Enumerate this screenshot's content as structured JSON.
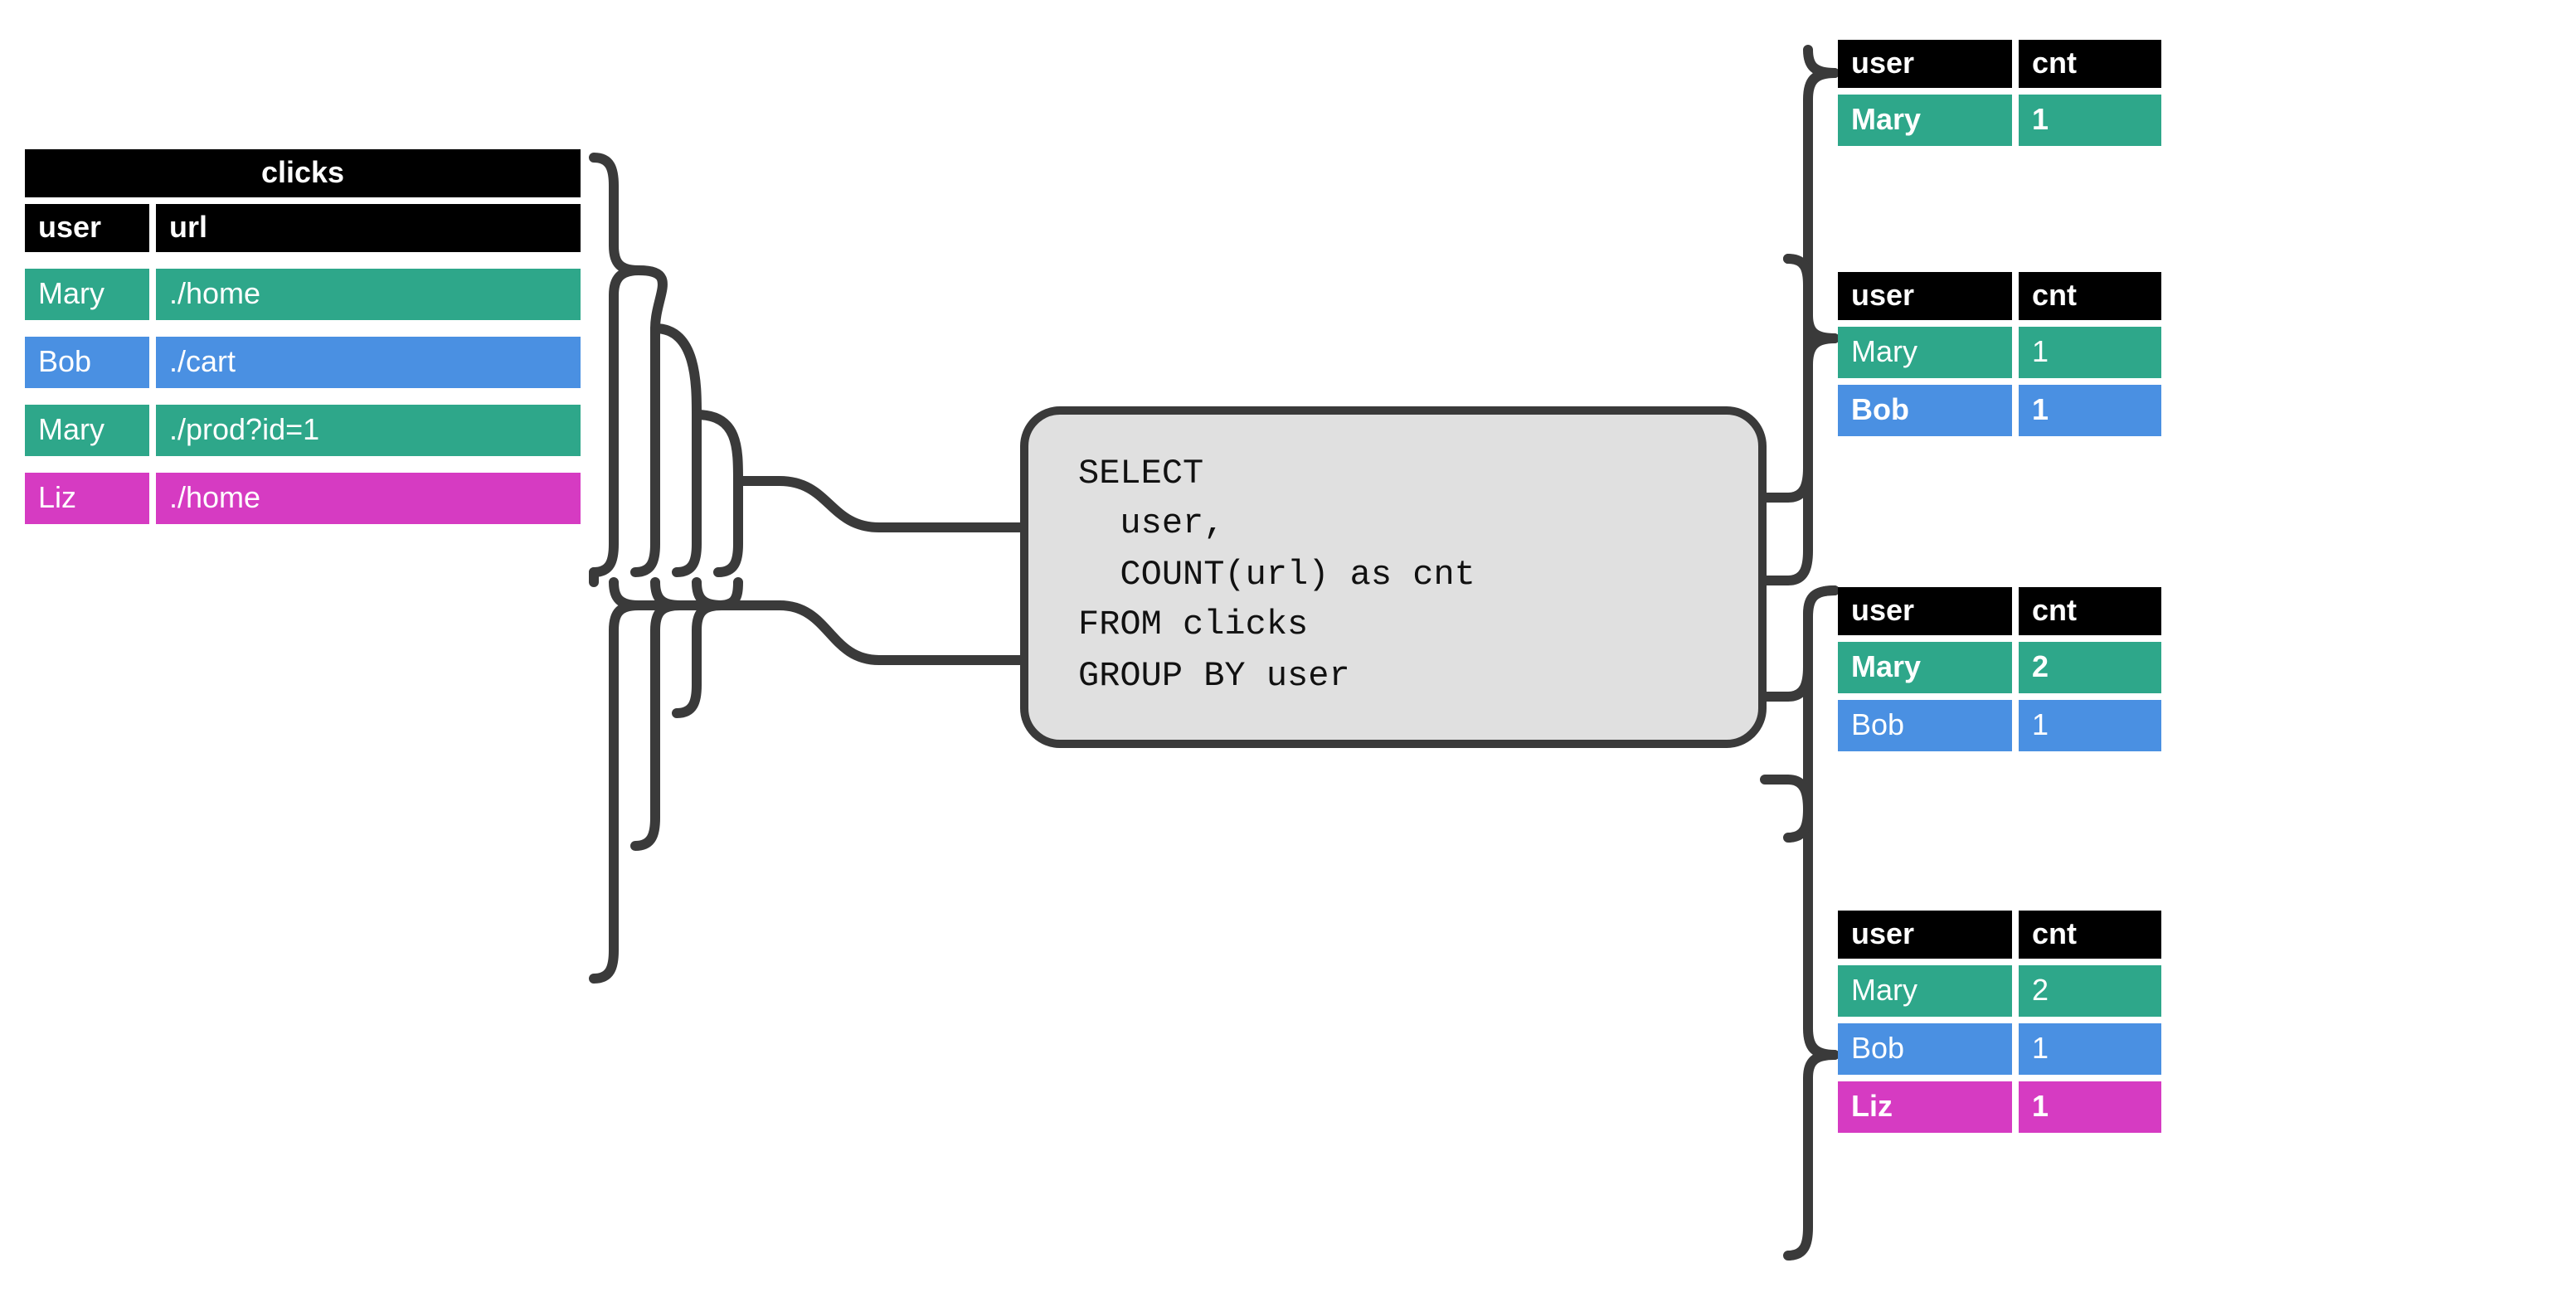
{
  "input_table": {
    "title": "clicks",
    "headers": [
      "user",
      "url"
    ],
    "rows": [
      {
        "user": "Mary",
        "url": "./home",
        "color": "green"
      },
      {
        "user": "Bob",
        "url": "./cart",
        "color": "blue"
      },
      {
        "user": "Mary",
        "url": "./prod?id=1",
        "color": "green"
      },
      {
        "user": "Liz",
        "url": "./home",
        "color": "pink"
      }
    ]
  },
  "sql": "SELECT\n  user,\n  COUNT(url) as cnt\nFROM clicks\nGROUP BY user",
  "output_snapshots": [
    {
      "headers": [
        "user",
        "cnt"
      ],
      "rows": [
        {
          "user": "Mary",
          "cnt": "1",
          "color": "green",
          "bold": true
        }
      ]
    },
    {
      "headers": [
        "user",
        "cnt"
      ],
      "rows": [
        {
          "user": "Mary",
          "cnt": "1",
          "color": "green",
          "bold": false
        },
        {
          "user": "Bob",
          "cnt": "1",
          "color": "blue",
          "bold": true
        }
      ]
    },
    {
      "headers": [
        "user",
        "cnt"
      ],
      "rows": [
        {
          "user": "Mary",
          "cnt": "2",
          "color": "green",
          "bold": true
        },
        {
          "user": "Bob",
          "cnt": "1",
          "color": "blue",
          "bold": false
        }
      ]
    },
    {
      "headers": [
        "user",
        "cnt"
      ],
      "rows": [
        {
          "user": "Mary",
          "cnt": "2",
          "color": "green",
          "bold": false
        },
        {
          "user": "Bob",
          "cnt": "1",
          "color": "blue",
          "bold": false
        },
        {
          "user": "Liz",
          "cnt": "1",
          "color": "pink",
          "bold": true
        }
      ]
    }
  ],
  "colors": {
    "green": "#2ea78a",
    "blue": "#4a90e2",
    "pink": "#d63bc2",
    "black": "#000000",
    "codebg": "#e0e0e0",
    "stroke": "#3a3a3a"
  }
}
